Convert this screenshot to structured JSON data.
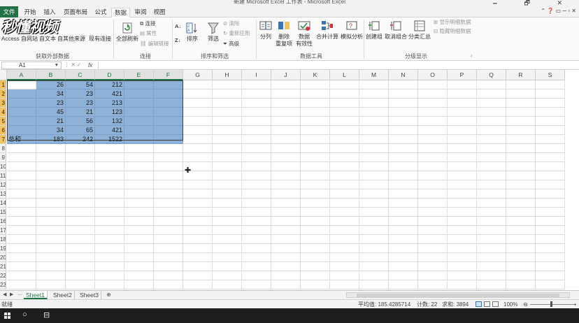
{
  "window": {
    "title": "新建 Microsoft Excel 工作表 - Microsoft Excel",
    "controls": "🗕 🗗 ✕"
  },
  "tabs": [
    "文件",
    "开始",
    "插入",
    "页面布局",
    "公式",
    "数据",
    "审阅",
    "视图"
  ],
  "active_tab": "数据",
  "watermark": "秒懂视频",
  "ribbon": {
    "get_external": {
      "access": "Access",
      "web": "自网站",
      "text": "自文本",
      "other": "自其他来源",
      "existing": "现有连接",
      "label": "获取外部数据"
    },
    "connections": {
      "refresh_all": "全部刷新",
      "conn": "连接",
      "props": "属性",
      "edit_links": "编辑链接",
      "label": "连接"
    },
    "sort_filter": {
      "sort": "排序",
      "filter": "筛选",
      "clear": "清除",
      "reapply": "重新应用",
      "advanced": "高级",
      "label": "排序和筛选"
    },
    "data_tools": {
      "split": "分列",
      "remove_dup_1": "删除",
      "remove_dup_2": "重复项",
      "validation_1": "数据",
      "validation_2": "有效性",
      "consolidate": "合并计算",
      "whatif": "模拟分析",
      "label": "数据工具"
    },
    "outline": {
      "group": "创建组",
      "ungroup": "取消组合",
      "subtotal": "分类汇总",
      "show_detail": "显示明细数据",
      "hide_detail": "隐藏明细数据",
      "label": "分级显示"
    }
  },
  "formula_bar": {
    "name_box": "A1",
    "fx": "fx",
    "value": ""
  },
  "columns": [
    "A",
    "B",
    "C",
    "D",
    "E",
    "F",
    "G",
    "H",
    "I",
    "J",
    "K",
    "L",
    "M",
    "N",
    "O",
    "P",
    "Q",
    "R",
    "S"
  ],
  "rows": [
    "1",
    "2",
    "3",
    "4",
    "5",
    "6",
    "7",
    "8",
    "9",
    "10",
    "11",
    "12",
    "13",
    "14",
    "15",
    "16",
    "17",
    "18",
    "19",
    "20",
    "21",
    "22",
    "23"
  ],
  "table": [
    [
      "",
      "26",
      "54",
      "212"
    ],
    [
      "",
      "34",
      "23",
      "421"
    ],
    [
      "",
      "23",
      "23",
      "213"
    ],
    [
      "",
      "45",
      "21",
      "123"
    ],
    [
      "",
      "21",
      "56",
      "132"
    ],
    [
      "",
      "34",
      "65",
      "421"
    ],
    [
      "总和",
      "183",
      "242",
      "1522"
    ]
  ],
  "sheets": [
    "Sheet1",
    "Sheet2",
    "Sheet3"
  ],
  "active_sheet": "Sheet1",
  "status": {
    "mode": "就绪",
    "average": "平均值: 185.4285714",
    "count": "计数: 22",
    "sum": "求和: 3894",
    "zoom": "100%"
  },
  "colors": {
    "excel_green": "#217346",
    "selection_fill": "#8eb1d7",
    "header_highlight": "#f2c35e"
  }
}
